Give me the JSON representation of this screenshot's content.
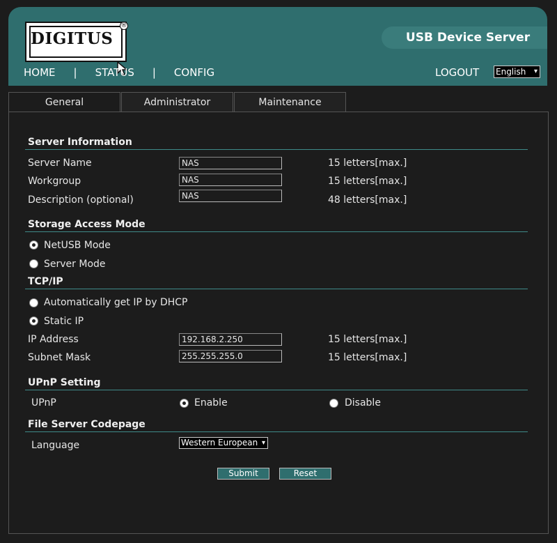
{
  "header": {
    "logo_text": "DIGITUS",
    "logo_reg": "®",
    "product_title": "USB Device Server",
    "nav": [
      "HOME",
      "STATUS",
      "CONFIG"
    ],
    "nav_separator": "|",
    "logout": "LOGOUT",
    "language": "English"
  },
  "tabs": [
    "General",
    "Administrator",
    "Maintenance"
  ],
  "server_info": {
    "title": "Server Information",
    "server_name_label": "Server Name",
    "server_name_value": "NAS",
    "server_name_limit": "15 letters[max.]",
    "workgroup_label": "Workgroup",
    "workgroup_value": "NAS",
    "workgroup_limit": "15 letters[max.]",
    "description_label": "Description (optional)",
    "description_value": "NAS",
    "description_limit": "48 letters[max.]"
  },
  "storage": {
    "title": "Storage Access Mode",
    "option_netusb": "NetUSB Mode",
    "option_server": "Server Mode"
  },
  "tcpip": {
    "title": "TCP/IP",
    "option_dhcp": "Automatically get IP by DHCP",
    "option_static": "Static IP",
    "ip_label": "IP Address",
    "ip_value": "192.168.2.250",
    "ip_limit": "15 letters[max.]",
    "mask_label": "Subnet Mask",
    "mask_value": "255.255.255.0",
    "mask_limit": "15 letters[max.]"
  },
  "upnp": {
    "title": "UPnP Setting",
    "label": "UPnP",
    "enable": "Enable",
    "disable": "Disable"
  },
  "codepage": {
    "title": "File Server Codepage",
    "label": "Language",
    "value": "Western European"
  },
  "buttons": {
    "submit": "Submit",
    "reset": "Reset"
  }
}
